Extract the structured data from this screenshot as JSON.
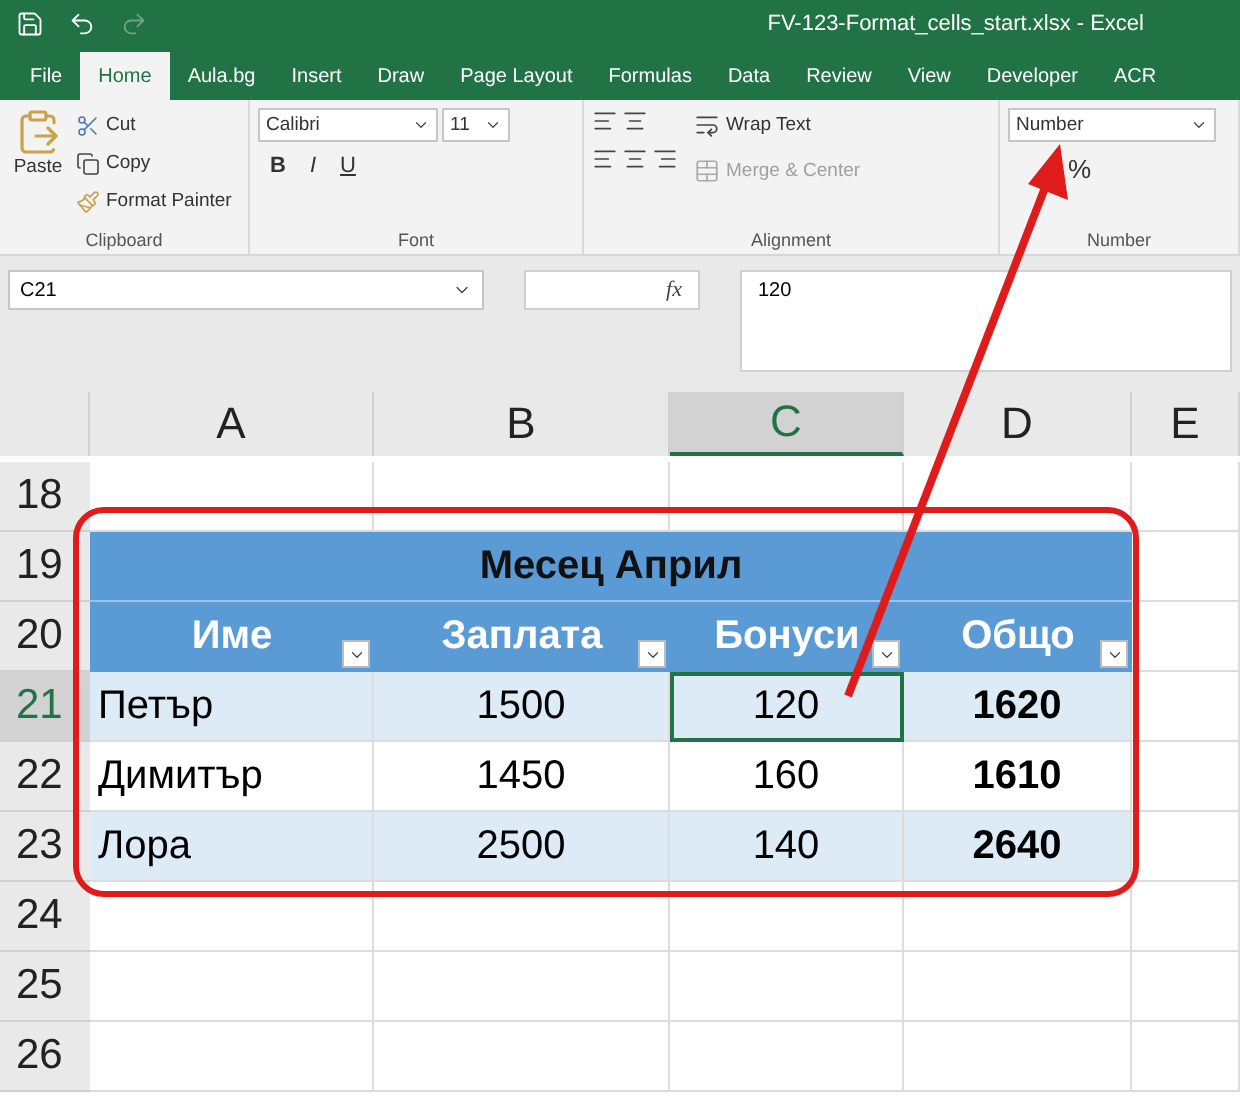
{
  "window": {
    "title": "FV-123-Format_cells_start.xlsx  -  Excel"
  },
  "tabs": [
    {
      "label": "File",
      "selected": false
    },
    {
      "label": "Home",
      "selected": true
    },
    {
      "label": "Aula.bg",
      "selected": false
    },
    {
      "label": "Insert",
      "selected": false
    },
    {
      "label": "Draw",
      "selected": false
    },
    {
      "label": "Page Layout",
      "selected": false
    },
    {
      "label": "Formulas",
      "selected": false
    },
    {
      "label": "Data",
      "selected": false
    },
    {
      "label": "Review",
      "selected": false
    },
    {
      "label": "View",
      "selected": false
    },
    {
      "label": "Developer",
      "selected": false
    },
    {
      "label": "ACR",
      "selected": false
    }
  ],
  "ribbon": {
    "clipboard": {
      "paste": "Paste",
      "cut": "Cut",
      "copy": "Copy",
      "format_painter": "Format Painter",
      "label": "Clipboard"
    },
    "font": {
      "name": "Calibri",
      "size": "11",
      "bold": "B",
      "italic": "I",
      "underline": "U",
      "label": "Font"
    },
    "alignment": {
      "wrap_text": "Wrap Text",
      "merge_center": "Merge & Center",
      "merge_disabled": true,
      "label": "Alignment"
    },
    "number": {
      "format": "Number",
      "percent": "%",
      "label": "Number"
    }
  },
  "formula_bar": {
    "name_box": "C21",
    "function_label": "fx",
    "value": "120"
  },
  "columns": [
    {
      "label": "A",
      "selected": false
    },
    {
      "label": "B",
      "selected": false
    },
    {
      "label": "C",
      "selected": true
    },
    {
      "label": "D",
      "selected": false
    },
    {
      "label": "E",
      "selected": false
    }
  ],
  "rows": [
    {
      "label": "18",
      "selected": false
    },
    {
      "label": "19",
      "selected": false
    },
    {
      "label": "20",
      "selected": false
    },
    {
      "label": "21",
      "selected": true
    },
    {
      "label": "22",
      "selected": false
    },
    {
      "label": "23",
      "selected": false
    },
    {
      "label": "24",
      "selected": false
    },
    {
      "label": "25",
      "selected": false
    },
    {
      "label": "26",
      "selected": false
    }
  ],
  "table": {
    "title": "Месец Април",
    "headers": [
      "Име",
      "Заплата",
      "Бонуси",
      "Общо"
    ],
    "rows": [
      {
        "cells": [
          {
            "text": "Петър",
            "selected": false
          },
          {
            "text": "1500",
            "selected": false
          },
          {
            "text": "120",
            "selected": true
          },
          {
            "text": "1620",
            "selected": false
          }
        ]
      },
      {
        "cells": [
          {
            "text": "Димитър",
            "selected": false
          },
          {
            "text": "1450",
            "selected": false
          },
          {
            "text": "160",
            "selected": false
          },
          {
            "text": "1610",
            "selected": false
          }
        ]
      },
      {
        "cells": [
          {
            "text": "Лора",
            "selected": false
          },
          {
            "text": "2500",
            "selected": false
          },
          {
            "text": "140",
            "selected": false
          },
          {
            "text": "2640",
            "selected": false
          }
        ]
      }
    ]
  }
}
